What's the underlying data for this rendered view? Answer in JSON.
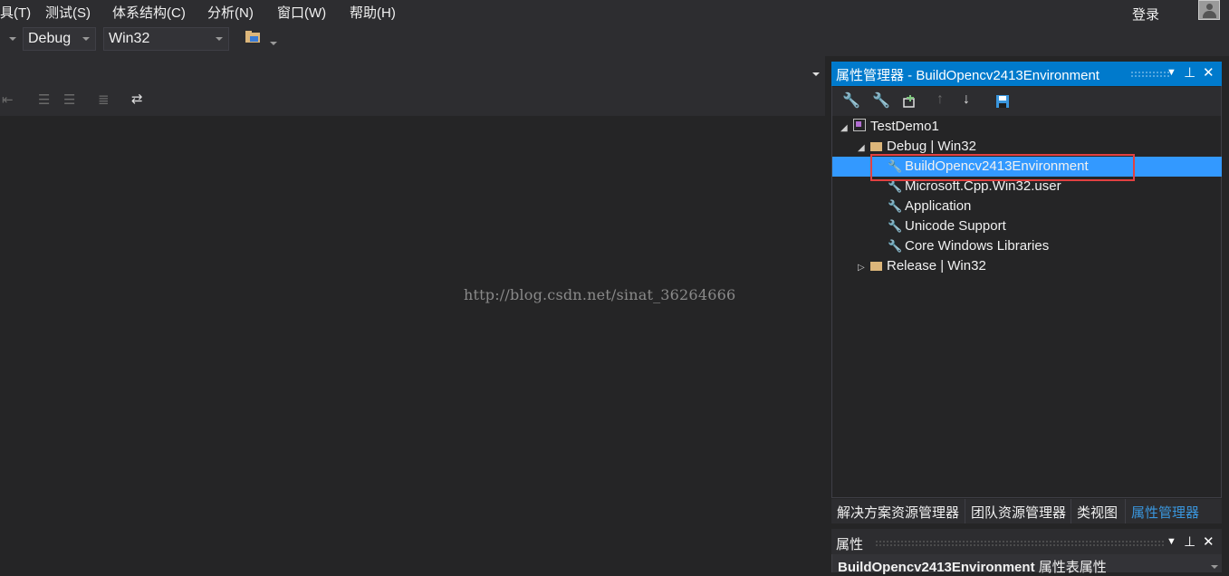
{
  "menu": {
    "items": [
      "具(T)",
      "测试(S)",
      "体系结构(C)",
      "分析(N)",
      "窗口(W)",
      "帮助(H)"
    ],
    "login": "登录"
  },
  "toolbar": {
    "configuration": "Debug",
    "platform": "Win32"
  },
  "editor": {
    "watermark": "http://blog.csdn.net/sinat_36264666"
  },
  "property_manager": {
    "title": "属性管理器 - BuildOpencv2413Environment",
    "tree": {
      "project": "TestDemo1",
      "debug_config": "Debug | Win32",
      "debug_children": [
        "BuildOpencv2413Environment",
        "Microsoft.Cpp.Win32.user",
        "Application",
        "Unicode Support",
        "Core Windows Libraries"
      ],
      "release_config": "Release | Win32"
    },
    "selected_item": "BuildOpencv2413Environment"
  },
  "tabs": [
    "解决方案资源管理器",
    "团队资源管理器",
    "类视图",
    "属性管理器"
  ],
  "active_tab": "属性管理器",
  "properties": {
    "title": "属性",
    "object_name": "BuildOpencv2413Environment",
    "object_type": "属性表属性"
  },
  "colors": {
    "accent": "#007acc",
    "selection": "#3399ff",
    "highlight_box": "#e24141",
    "background": "#252526"
  }
}
